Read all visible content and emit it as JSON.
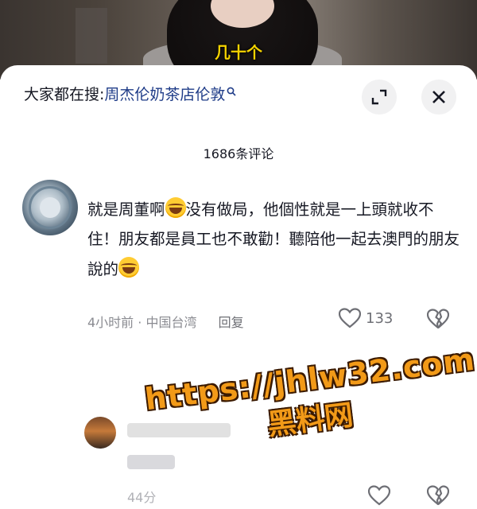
{
  "video": {
    "caption": "几十个"
  },
  "search": {
    "prefix": "大家都在搜:",
    "query": "周杰伦奶茶店伦敦"
  },
  "header": {
    "comment_count": "1686条评论"
  },
  "comments": [
    {
      "text_parts": [
        "就是周董啊",
        "没有做局，他個性就是一上頭就收不住！朋友都是員工也不敢勸！聽陪他一起去澳門的朋友說的"
      ],
      "emojis": [
        "sweat-laugh-emoji",
        "laugh-cry-emoji"
      ],
      "time": "4小时前",
      "location": "中国台湾",
      "reply_label": "回复",
      "likes": "133"
    },
    {
      "time": "44分"
    }
  ],
  "watermark": {
    "url": "https://jhlw32.com",
    "brand": "黑料网"
  },
  "colors": {
    "link": "#1f3c88",
    "watermark": "#f29a18",
    "caption": "#f5d300"
  }
}
